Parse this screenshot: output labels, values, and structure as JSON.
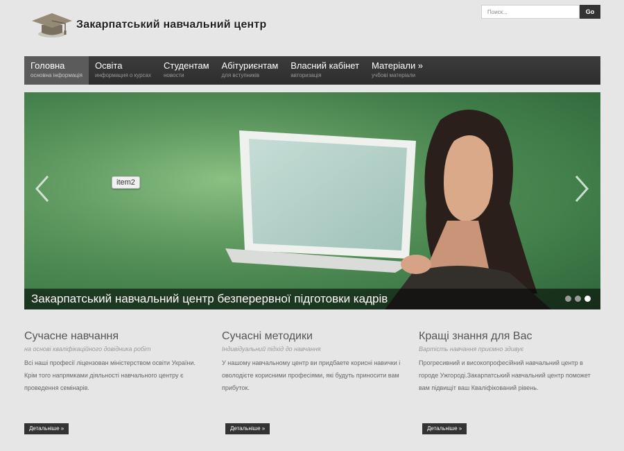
{
  "header": {
    "site_name": "Закарпатський навчальний центр",
    "logo_icon": "graduation-cap-icon"
  },
  "search": {
    "placeholder": "Поиск...",
    "button_label": "Go"
  },
  "nav": {
    "items": [
      {
        "label": "Головна",
        "sub": "основна інформація",
        "active": true
      },
      {
        "label": "Освіта",
        "sub": "информация о курсах"
      },
      {
        "label": "Студентам",
        "sub": "новости"
      },
      {
        "label": "Абітуриєнтам",
        "sub": "для вступників"
      },
      {
        "label": "Власний кабінет",
        "sub": "авторизація"
      },
      {
        "label": "Матеріали »",
        "sub": "учбові матеріали"
      }
    ]
  },
  "slider": {
    "tooltip": "item2",
    "caption": "Закарпатський навчальний центр безперервної підготовки кадрів",
    "prev_icon": "chevron-left-icon",
    "next_icon": "chevron-right-icon",
    "slide_count": 3,
    "active_slide": 3
  },
  "columns": [
    {
      "title": "Сучасне навчання",
      "subtitle": "на основі кваліфікаційного довідника робіт",
      "text": "Всі наші професії ліцензован міністерством освіти України. Крім того напрямками діяльності навчального центру є проведення семінарів.",
      "more": "Детальніше »"
    },
    {
      "title": "Сучасні методики",
      "subtitle": "Індивідуальний підхід до навчання",
      "text": "У нашому навчальному центр ви придбаете корисні навички і оволодієте корисними професіями, які будуть приносити вам прибуток.",
      "more": "Детальніше »"
    },
    {
      "title": "Кращі знання для Вас",
      "subtitle": "Вартість навчання приємно здивує",
      "text": "Прогресивний и високопрофесійний навчальний центр в городе Ужгороді.Закарпатський навчальний центр поможет вам підвищіт ваш Кваліфікований рівень.",
      "more": "Детальніше »"
    }
  ],
  "colors": {
    "nav_bg": "#333333",
    "nav_active": "#5b5b5b",
    "slide_bg": "#5c9a5e",
    "button_bg": "#333333"
  }
}
